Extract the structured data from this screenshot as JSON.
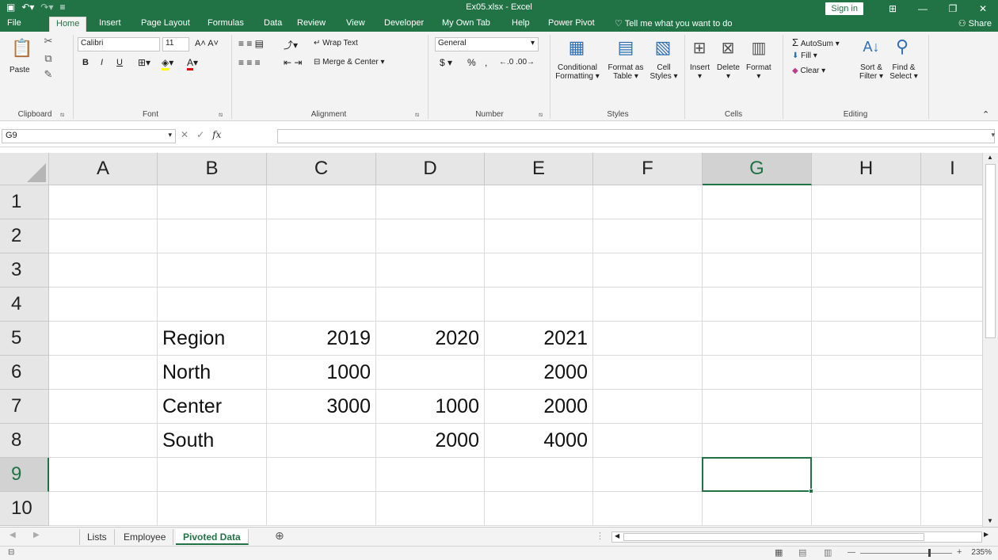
{
  "window": {
    "title": "Ex05.xlsx  -  Excel",
    "sign_in": "Sign in",
    "quick_access": [
      "save-icon",
      "undo-icon",
      "redo-icon",
      "customize-icon"
    ]
  },
  "menu": {
    "tabs": [
      "File",
      "Home",
      "Insert",
      "Page Layout",
      "Formulas",
      "Data",
      "Review",
      "View",
      "Developer",
      "My Own Tab",
      "Help",
      "Power Pivot"
    ],
    "active_tab": "Home",
    "tell_me": "Tell me what you want to do",
    "share": "Share"
  },
  "ribbon": {
    "clipboard": {
      "label": "Clipboard",
      "paste": "Paste"
    },
    "font": {
      "label": "Font",
      "name": "Calibri",
      "size": "11",
      "bold": "B",
      "italic": "I",
      "underline": "U"
    },
    "alignment": {
      "label": "Alignment",
      "wrap_text": "Wrap Text",
      "merge_center": "Merge & Center"
    },
    "number": {
      "label": "Number",
      "format": "General",
      "currency": "$",
      "percent": "%",
      "comma": ","
    },
    "styles": {
      "label": "Styles",
      "conditional_1": "Conditional",
      "conditional_2": "Formatting",
      "format_table_1": "Format as",
      "format_table_2": "Table",
      "cell_styles_1": "Cell",
      "cell_styles_2": "Styles"
    },
    "cells": {
      "label": "Cells",
      "insert": "Insert",
      "delete": "Delete",
      "format": "Format"
    },
    "editing": {
      "label": "Editing",
      "autosum": "AutoSum",
      "fill": "Fill",
      "clear": "Clear",
      "sort_1": "Sort &",
      "sort_2": "Filter",
      "find_1": "Find &",
      "find_2": "Select"
    }
  },
  "formula_bar": {
    "name_box": "G9",
    "fx": "fx",
    "formula": ""
  },
  "grid": {
    "columns": [
      "A",
      "B",
      "C",
      "D",
      "E",
      "F",
      "G",
      "H",
      "I"
    ],
    "rows": [
      "1",
      "2",
      "3",
      "4",
      "5",
      "6",
      "7",
      "8",
      "9",
      "10"
    ],
    "selected_cell": "G9",
    "data": {
      "B5": "Region",
      "C5": "2019",
      "D5": "2020",
      "E5": "2021",
      "B6": "North",
      "C6": "1000",
      "E6": "2000",
      "B7": "Center",
      "C7": "3000",
      "D7": "1000",
      "E7": "2000",
      "B8": "South",
      "D8": "2000",
      "E8": "4000"
    }
  },
  "sheets": {
    "tabs": [
      "Lists",
      "Employee",
      "Pivoted Data"
    ],
    "active": "Pivoted Data"
  },
  "status": {
    "zoom": "235%"
  },
  "colors": {
    "accent": "#217346",
    "ribbon_bg": "#f3f3f3"
  }
}
